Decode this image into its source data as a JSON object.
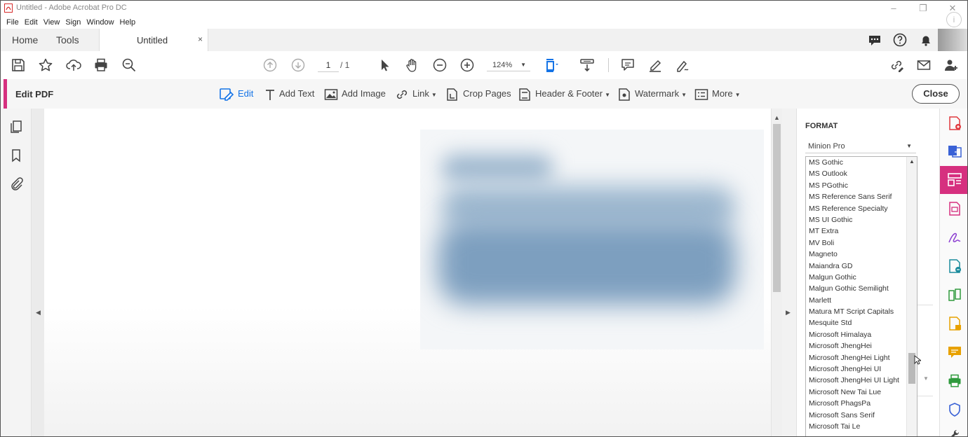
{
  "window": {
    "title": "Untitled - Adobe Acrobat Pro DC",
    "minimize": "–",
    "restore": "❐",
    "close": "✕"
  },
  "menu": [
    "File",
    "Edit",
    "View",
    "Sign",
    "Window",
    "Help"
  ],
  "tabs": {
    "home": "Home",
    "tools": "Tools",
    "document": "Untitled",
    "document_close": "×"
  },
  "toolbar": {
    "current_page": "1",
    "total_pages": "/ 1",
    "zoom": "124%"
  },
  "edit_bar": {
    "label": "Edit PDF",
    "edit": "Edit",
    "add_text": "Add Text",
    "add_image": "Add Image",
    "link": "Link",
    "crop_pages": "Crop Pages",
    "header_footer": "Header & Footer",
    "watermark": "Watermark",
    "more": "More",
    "close": "Close"
  },
  "format_panel": {
    "title": "FORMAT",
    "selected_font": "Minion Pro",
    "font_list": [
      "MS Gothic",
      "MS Outlook",
      "MS PGothic",
      "MS Reference Sans Serif",
      "MS Reference Specialty",
      "MS UI Gothic",
      "MT Extra",
      "MV Boli",
      "Magneto",
      "Maiandra GD",
      "Malgun Gothic",
      "Malgun Gothic Semilight",
      "Marlett",
      "Matura MT Script Capitals",
      "Mesquite Std",
      "Microsoft Himalaya",
      "Microsoft JhengHei",
      "Microsoft JhengHei Light",
      "Microsoft JhengHei UI",
      "Microsoft JhengHei UI Light",
      "Microsoft New Tai Lue",
      "Microsoft PhagsPa",
      "Microsoft Sans Serif",
      "Microsoft Tai Le"
    ]
  },
  "colors": {
    "accent_pink": "#d6307f",
    "active_blue": "#1473e6"
  }
}
